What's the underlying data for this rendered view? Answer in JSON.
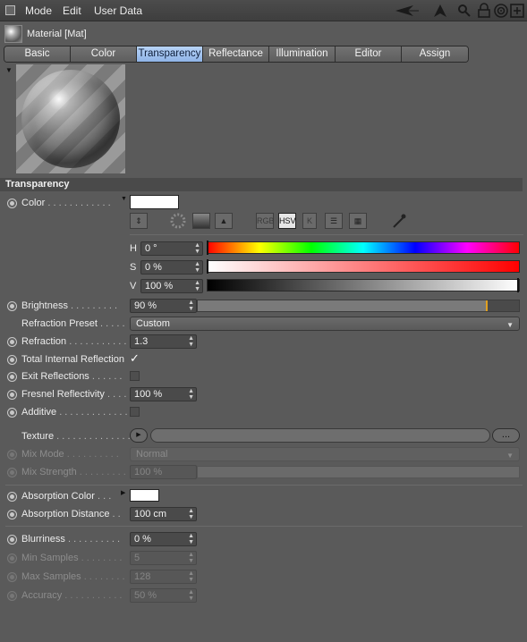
{
  "menu": {
    "items": [
      "Mode",
      "Edit",
      "User Data"
    ]
  },
  "toolbar_icons": [
    "back-arrow-icon",
    "up-arrow-icon",
    "search-icon",
    "lock-icon",
    "target-icon",
    "new-window-icon"
  ],
  "material": {
    "title": "Material [Mat]"
  },
  "tabs": [
    {
      "label": "Basic",
      "active": false
    },
    {
      "label": "Color",
      "active": false
    },
    {
      "label": "Transparency",
      "active": true
    },
    {
      "label": "Reflectance",
      "active": false
    },
    {
      "label": "Illumination",
      "active": false
    },
    {
      "label": "Editor",
      "active": false
    },
    {
      "label": "Assign",
      "active": false
    }
  ],
  "section": {
    "title": "Transparency"
  },
  "color": {
    "label": "Color",
    "swatch": "#ffffff",
    "picker_icons": [
      "eyedropper-toggle",
      "color-wheel",
      "spectrum",
      "image",
      "RGB",
      "HSV",
      "K",
      "mixer",
      "swatches",
      "picker"
    ],
    "h": {
      "label": "H",
      "value": "0 °"
    },
    "s": {
      "label": "S",
      "value": "0 %"
    },
    "v": {
      "label": "V",
      "value": "100 %"
    }
  },
  "brightness": {
    "label": "Brightness",
    "value": "90 %",
    "fraction": 0.9
  },
  "refraction_preset": {
    "label": "Refraction Preset",
    "value": "Custom"
  },
  "refraction": {
    "label": "Refraction",
    "value": "1.3"
  },
  "total_internal_reflection": {
    "label": "Total Internal Reflection",
    "checked": true,
    "check_glyph": "✓"
  },
  "exit_reflections": {
    "label": "Exit Reflections",
    "checked": false
  },
  "fresnel_reflectivity": {
    "label": "Fresnel Reflectivity",
    "value": "100 %"
  },
  "additive": {
    "label": "Additive",
    "checked": false
  },
  "texture": {
    "label": "Texture",
    "button": "..."
  },
  "mix_mode": {
    "label": "Mix Mode",
    "value": "Normal"
  },
  "mix_strength": {
    "label": "Mix Strength",
    "value": "100 %"
  },
  "absorption_color": {
    "label": "Absorption Color",
    "swatch": "#ffffff"
  },
  "absorption_distance": {
    "label": "Absorption Distance",
    "value": "100 cm"
  },
  "blurriness": {
    "label": "Blurriness",
    "value": "0 %"
  },
  "min_samples": {
    "label": "Min Samples",
    "value": "5"
  },
  "max_samples": {
    "label": "Max Samples",
    "value": "128"
  },
  "accuracy": {
    "label": "Accuracy",
    "value": "50 %"
  },
  "colors": {
    "accent_tab": "#9fc0ee",
    "panel_bg": "#5a5a5a",
    "marker": "#e0a020"
  }
}
